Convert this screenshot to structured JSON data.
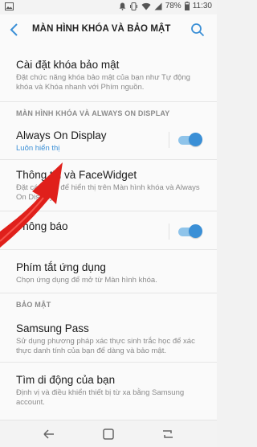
{
  "status": {
    "battery": "78%",
    "time": "11:30"
  },
  "appbar": {
    "title": "MÀN HÌNH KHÓA VÀ BẢO MẬT"
  },
  "items": {
    "lock_settings": {
      "title": "Cài đặt khóa bảo mật",
      "subtitle": "Đặt chức năng khóa bảo mật của bạn như Tự động khóa và Khóa nhanh với Phím nguồn."
    },
    "section_aod": "MÀN HÌNH KHÓA VÀ ALWAYS ON DISPLAY",
    "aod": {
      "title": "Always On Display",
      "subtitle": "Luôn hiển thị",
      "enabled": true
    },
    "faceinfo": {
      "title": "Thông tin và FaceWidget",
      "subtitle": "Đặt các mục để hiển thị trên Màn hình khóa và Always On Display."
    },
    "notifications": {
      "title": "Thông báo",
      "enabled": true
    },
    "shortcuts": {
      "title": "Phím tắt ứng dụng",
      "subtitle": "Chọn ứng dụng để mở từ Màn hình khóa."
    },
    "section_security": "BẢO MẬT",
    "samsung_pass": {
      "title": "Samsung Pass",
      "subtitle": "Sử dụng phương pháp xác thực sinh trắc học để xác thực danh tính của bạn để dàng và bảo mật."
    },
    "find_device": {
      "title": "Tìm di động của bạn",
      "subtitle": "Định vị và điều khiển thiết bị từ xa bằng Samsung account."
    }
  },
  "colors": {
    "accent": "#3a8fd6",
    "arrow": "#e0201b"
  },
  "icons": [
    "gallery-icon",
    "notification-icon",
    "vibrate-icon",
    "wifi-icon",
    "signal-icon",
    "battery-icon",
    "back-arrow-icon",
    "search-icon",
    "recents-icon",
    "home-icon",
    "back-nav-icon"
  ]
}
